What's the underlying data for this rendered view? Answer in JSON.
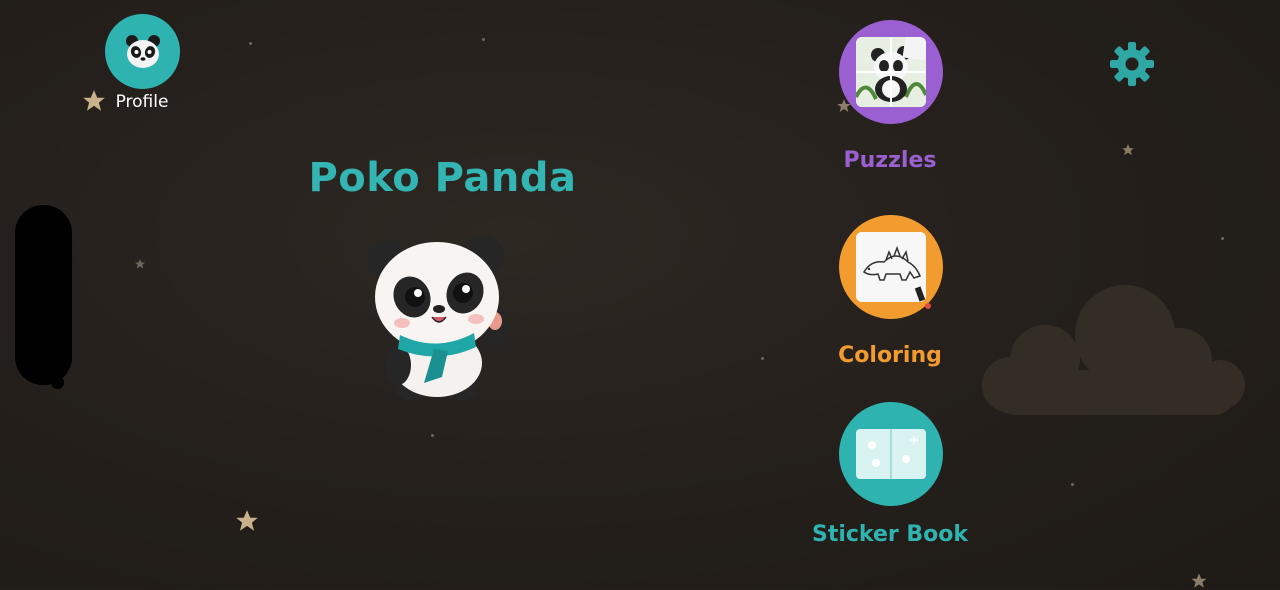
{
  "app": {
    "title": "Poko Panda"
  },
  "profile": {
    "label": "Profile",
    "icon": "panda-face-icon"
  },
  "settings": {
    "icon": "gear-icon",
    "color": "#2ea7a5"
  },
  "activities": [
    {
      "label": "Puzzles",
      "color": "#9a5fd0",
      "icon": "panda-puzzle-icon"
    },
    {
      "label": "Coloring",
      "color": "#f29b2f",
      "icon": "dinosaur-coloring-icon"
    },
    {
      "label": "Sticker Book",
      "color": "#2fb3b1",
      "icon": "sticker-book-icon"
    }
  ],
  "colors": {
    "brand_teal": "#33b5b3",
    "background": "#241f1b"
  }
}
